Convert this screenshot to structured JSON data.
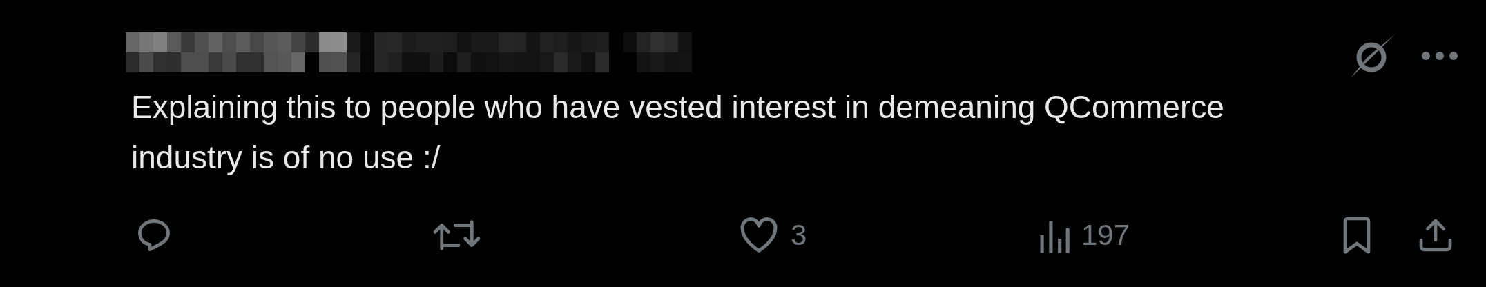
{
  "post": {
    "text": "Explaining this to people who have vested interest in demeaning QCommerce industry is of no use :/",
    "actions": [
      {
        "kind": "reply"
      },
      {
        "kind": "repost"
      },
      {
        "kind": "like",
        "count": "3"
      },
      {
        "kind": "views",
        "count": "197"
      },
      {
        "kind": "bookmark"
      },
      {
        "kind": "share"
      }
    ]
  }
}
